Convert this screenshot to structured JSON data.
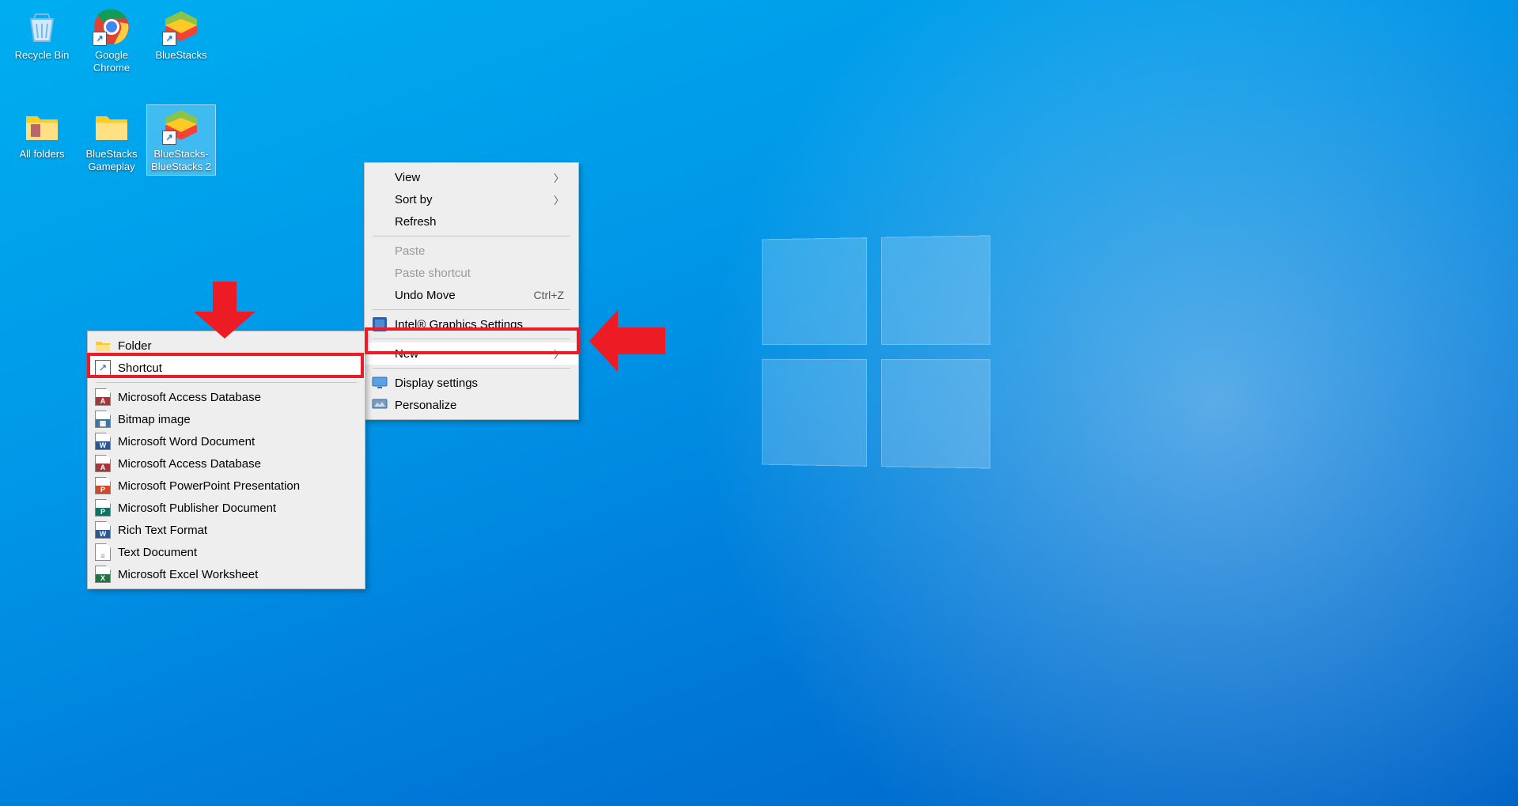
{
  "desktop_icons": {
    "recycle": "Recycle Bin",
    "chrome": "Google Chrome",
    "bluestacks": "BlueStacks",
    "allfolders": "All folders",
    "bsgameplay": "BlueStacks Gameplay",
    "bs2": "BlueStacks-BlueStacks 2"
  },
  "context_menu": {
    "view": "View",
    "sortby": "Sort by",
    "refresh": "Refresh",
    "paste": "Paste",
    "paste_shortcut": "Paste shortcut",
    "undo_move": "Undo Move",
    "undo_move_shortcut": "Ctrl+Z",
    "intel": "Intel® Graphics Settings",
    "new": "New",
    "display": "Display settings",
    "personalize": "Personalize"
  },
  "new_submenu": {
    "folder": "Folder",
    "shortcut": "Shortcut",
    "access": "Microsoft Access Database",
    "bitmap": "Bitmap image",
    "word": "Microsoft Word Document",
    "access2": "Microsoft Access Database",
    "ppt": "Microsoft PowerPoint Presentation",
    "publisher": "Microsoft Publisher Document",
    "rtf": "Rich Text Format",
    "txt": "Text Document",
    "excel": "Microsoft Excel Worksheet"
  }
}
